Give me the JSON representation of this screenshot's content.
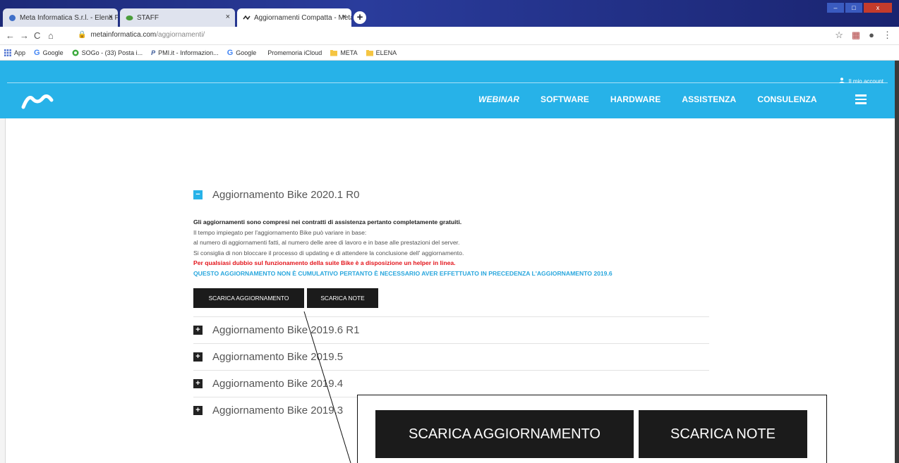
{
  "browser": {
    "tabs": [
      {
        "title": "Meta Informatica S.r.l. - Elena Fic",
        "active": false
      },
      {
        "title": "STAFF",
        "active": false
      },
      {
        "title": "Aggiornamenti Compatta - Meta",
        "active": true
      }
    ],
    "url_host": "metainformatica.com",
    "url_path": "/aggiornamenti/",
    "bookmarks": [
      {
        "label": "App",
        "icon": "apps-grid-icon"
      },
      {
        "label": "Google",
        "icon": "google-icon"
      },
      {
        "label": "SOGo - (33) Posta i...",
        "icon": "sogo-icon"
      },
      {
        "label": "PMI.it - Informazion...",
        "icon": "pmi-icon"
      },
      {
        "label": "Google",
        "icon": "google-icon"
      },
      {
        "label": "Promemoria iCloud",
        "icon": "apple-icon"
      },
      {
        "label": "META",
        "icon": "folder-icon"
      },
      {
        "label": "ELENA",
        "icon": "folder-icon"
      }
    ]
  },
  "header": {
    "account_label": "Il mio account",
    "menu": [
      "WEBINAR",
      "SOFTWARE",
      "HARDWARE",
      "ASSISTENZA",
      "CONSULENZA"
    ],
    "brand_color": "#27b2e8"
  },
  "accordion": {
    "expanded": {
      "title": "Aggiornamento Bike 2020.1 R0",
      "bold_line": "Gli aggiornamenti sono compresi nei contratti di assistenza pertanto completamente gratuiti.",
      "lines": [
        "Il tempo impiegato per l'aggiornamento Bike può variare in base:",
        "al numero di aggiornamenti fatti, al numero delle aree di lavoro e in base alle prestazioni del server.",
        "Si consiglia di non bloccare il processo di updating e di attendere la conclusione dell' aggiornamento."
      ],
      "red_line": "Per qualsiasi dubbio sul funzionamento della suite Bike è a disposizione un helper in linea.",
      "blue_line": "QUESTO AGGIORNAMENTO NON È CUMULATIVO PERTANTO È NECESSARIO AVER EFFETTUATO IN PRECEDENZA L'AGGIORNAMENTO 2019.6",
      "download_label": "SCARICA AGGIORNAMENTO",
      "notes_label": "SCARICA NOTE"
    },
    "collapsed": [
      "Aggiornamento Bike 2019.6 R1",
      "Aggiornamento Bike 2019.5",
      "Aggiornamento Bike 2019.4",
      "Aggiornamento Bike 2019.3"
    ]
  },
  "zoom": {
    "download_label": "SCARICA AGGIORNAMENTO",
    "notes_label": "SCARICA NOTE"
  }
}
